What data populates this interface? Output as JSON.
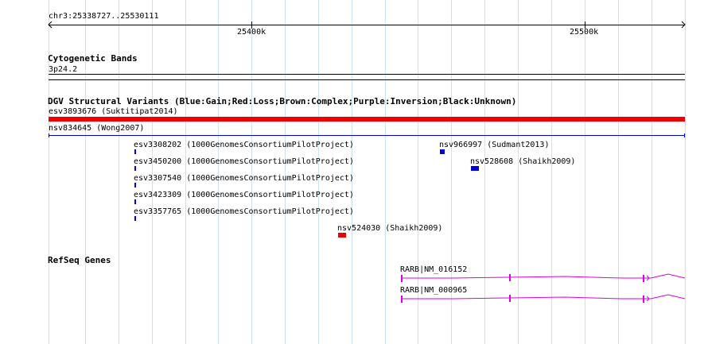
{
  "ruler": {
    "location": "chr3:25338727..25530111",
    "ticks": [
      "25400k",
      "25500k"
    ]
  },
  "cytobands": {
    "title": "Cytogenetic Bands",
    "band": "3p24.2"
  },
  "dgv": {
    "title": "DGV Structural Variants (Blue:Gain;Red:Loss;Brown:Complex;Purple:Inversion;Black:Unknown)",
    "colors": {
      "gain": "#0000dd",
      "loss": "#ee0000",
      "unknown_line": "#0000cc"
    },
    "features": [
      {
        "label": "esv3893676 (Suktitipat2014)"
      },
      {
        "label": "nsv834645 (Wong2007)"
      },
      {
        "label": "esv3308202 (1000GenomesConsortiumPilotProject)"
      },
      {
        "label": "esv3450200 (1000GenomesConsortiumPilotProject)"
      },
      {
        "label": "esv3307540 (1000GenomesConsortiumPilotProject)"
      },
      {
        "label": "esv3423309 (1000GenomesConsortiumPilotProject)"
      },
      {
        "label": "esv3357765 (1000GenomesConsortiumPilotProject)"
      },
      {
        "label": "nsv966997 (Sudmant2013)"
      },
      {
        "label": "nsv528608 (Shaikh2009)"
      },
      {
        "label": "nsv524030 (Shaikh2009)"
      }
    ]
  },
  "refseq": {
    "title": "RefSeq Genes",
    "color": "#dd00dd",
    "genes": [
      {
        "label": "RARB|NM_016152"
      },
      {
        "label": "RARB|NM_000965"
      }
    ]
  }
}
